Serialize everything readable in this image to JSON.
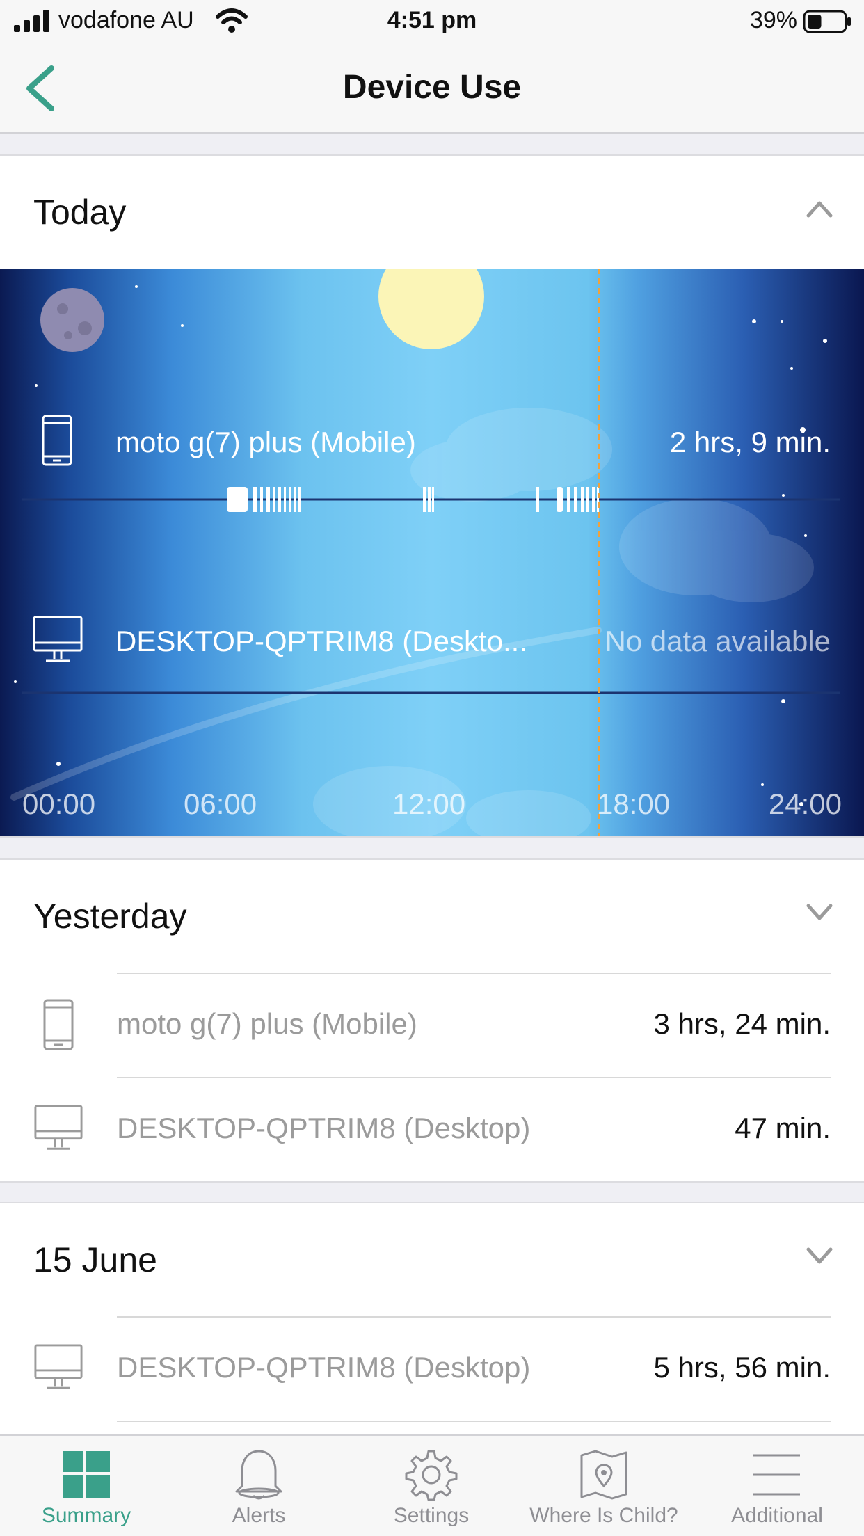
{
  "status_bar": {
    "carrier": "vodafone AU",
    "time": "4:51 pm",
    "battery_percent": "39%",
    "battery_level": 0.39
  },
  "nav": {
    "title": "Device Use"
  },
  "colors": {
    "accent": "#3aa08a",
    "usage_marker": "#f0a23c"
  },
  "today": {
    "title": "Today",
    "expanded": true,
    "devices": [
      {
        "icon": "mobile-icon",
        "name": "moto g(7) plus (Mobile)",
        "value": "2 hrs, 9 min."
      },
      {
        "icon": "desktop-icon",
        "name": "DESKTOP-QPTRIM8 (Deskto...",
        "value": "No data available"
      }
    ],
    "time_axis": [
      "00:00",
      "06:00",
      "12:00",
      "18:00",
      "24:00"
    ]
  },
  "yesterday": {
    "title": "Yesterday",
    "expanded": false,
    "devices": [
      {
        "icon": "mobile-icon",
        "name": "moto g(7) plus (Mobile)",
        "value": "3 hrs, 24 min."
      },
      {
        "icon": "desktop-icon",
        "name": "DESKTOP-QPTRIM8 (Desktop)",
        "value": "47 min."
      }
    ]
  },
  "day_15_june": {
    "title": "15 June",
    "expanded": false,
    "devices": [
      {
        "icon": "desktop-icon",
        "name": "DESKTOP-QPTRIM8 (Desktop)",
        "value": "5 hrs, 56 min."
      }
    ]
  },
  "tabs": [
    {
      "label": "Summary",
      "icon": "summary-icon",
      "active": true
    },
    {
      "label": "Alerts",
      "icon": "bell-icon",
      "active": false
    },
    {
      "label": "Settings",
      "icon": "gear-icon",
      "active": false
    },
    {
      "label": "Where Is Child?",
      "icon": "map-pin-icon",
      "active": false
    },
    {
      "label": "Additional",
      "icon": "menu-icon",
      "active": false
    }
  ]
}
